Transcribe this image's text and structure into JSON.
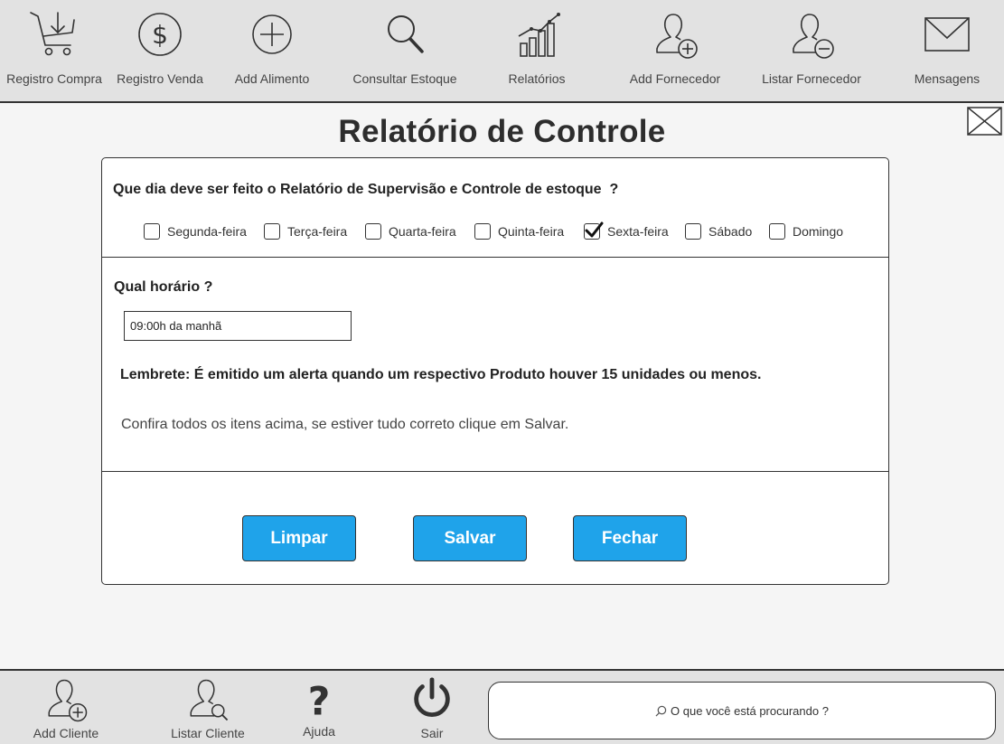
{
  "toolbar": {
    "items": [
      {
        "label": "Registro Compra",
        "icon": "cart-download-icon"
      },
      {
        "label": "Registro Venda",
        "icon": "dollar-circle-icon"
      },
      {
        "label": "Add Alimento",
        "icon": "plus-circle-icon"
      },
      {
        "label": "Consultar Estoque",
        "icon": "search-icon"
      },
      {
        "label": "Relatórios",
        "icon": "bar-chart-icon"
      },
      {
        "label": "Add Fornecedor",
        "icon": "user-add-icon"
      },
      {
        "label": "Listar Fornecedor",
        "icon": "user-remove-icon"
      },
      {
        "label": "Mensagens",
        "icon": "envelope-icon"
      }
    ]
  },
  "page": {
    "title": "Relatório de Controle"
  },
  "form": {
    "question_day": "Que dia deve ser feito o Relatório de Supervisão e Controle de estoque  ?",
    "days": [
      {
        "label": "Segunda-feira",
        "checked": false
      },
      {
        "label": "Terça-feira",
        "checked": false
      },
      {
        "label": "Quarta-feira",
        "checked": false
      },
      {
        "label": "Quinta-feira",
        "checked": false
      },
      {
        "label": "Sexta-feira",
        "checked": true
      },
      {
        "label": "Sábado",
        "checked": false
      },
      {
        "label": "Domingo",
        "checked": false
      }
    ],
    "question_time": "Qual horário ?",
    "time_value": "09:00h da manhã",
    "reminder": "Lembrete: É emitido um alerta quando um respectivo Produto houver 15 unidades ou menos.",
    "confirm_text": "Confira todos os itens acima, se estiver tudo correto clique em Salvar."
  },
  "buttons": {
    "clear": "Limpar",
    "save": "Salvar",
    "close": "Fechar"
  },
  "bottom": {
    "items": [
      {
        "label": "Add Cliente",
        "icon": "user-add-icon"
      },
      {
        "label": "Listar Cliente",
        "icon": "user-search-icon"
      },
      {
        "label": "Ajuda",
        "icon": "question-icon"
      },
      {
        "label": "Sair",
        "icon": "power-icon"
      }
    ],
    "search_placeholder": "O que você está procurando ?"
  },
  "colors": {
    "button_accent": "#1fa3ea",
    "bar_background": "#e2e2e2"
  }
}
